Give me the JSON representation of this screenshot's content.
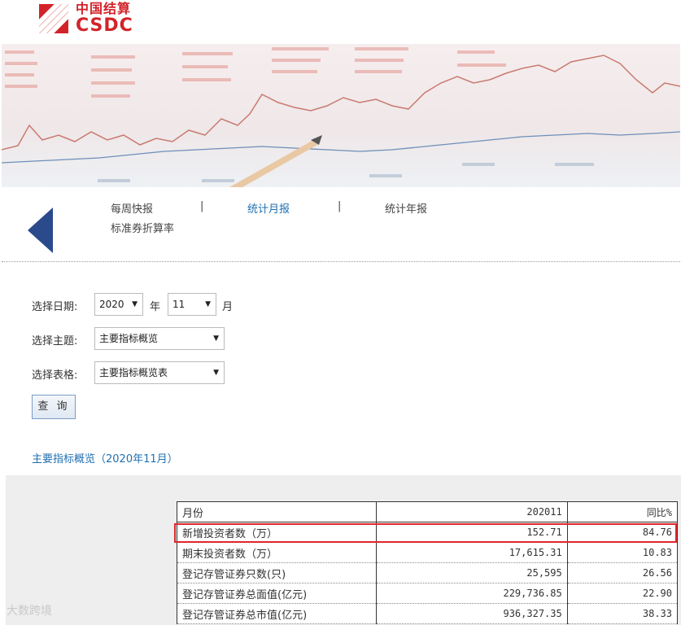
{
  "header": {
    "logo_cn": "中国结算",
    "logo_en": "CSDC"
  },
  "nav": {
    "items": [
      {
        "label": "每周快报",
        "active": false
      },
      {
        "label": "统计月报",
        "active": true
      },
      {
        "label": "统计年报",
        "active": false
      },
      {
        "label": "标准券折算率",
        "active": false
      }
    ],
    "separator": "|"
  },
  "form": {
    "date_label": "选择日期:",
    "year_value": "2020",
    "year_unit": "年",
    "month_value": "11",
    "month_unit": "月",
    "topic_label": "选择主题:",
    "topic_value": "主要指标概览",
    "table_label": "选择表格:",
    "table_value": "主要指标概览表",
    "query_button": "查 询"
  },
  "section_title": "主要指标概览（2020年11月）",
  "table": {
    "headers": [
      "月份",
      "202011",
      "同比%"
    ],
    "rows": [
      [
        "新增投资者数（万）",
        "152.71",
        "84.76"
      ],
      [
        "期末投资者数（万）",
        "17,615.31",
        "10.83"
      ],
      [
        "登记存管证券只数(只)",
        "25,595",
        "26.56"
      ],
      [
        "登记存管证券总面值(亿元)",
        "229,736.85",
        "22.90"
      ],
      [
        "登记存管证券总市值(亿元)",
        "936,327.35",
        "38.33"
      ]
    ]
  },
  "watermark": "大数跨境",
  "colors": {
    "brand_red": "#d2232a",
    "nav_active": "#1f6fb0",
    "arrow_blue": "#2a4a8c",
    "highlight_red": "#e0272b"
  }
}
